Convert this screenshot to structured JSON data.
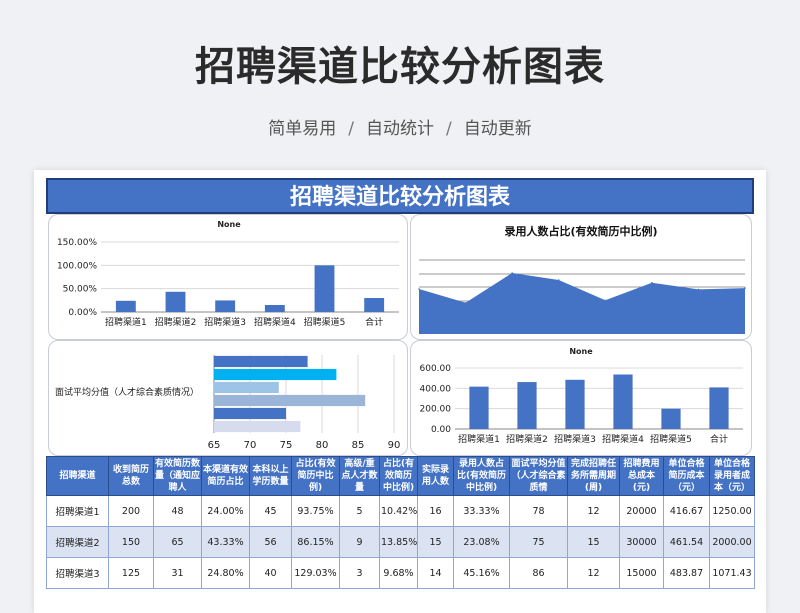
{
  "page": {
    "title": "招聘渠道比较分析图表",
    "subtitle": [
      "简单易用",
      "自动统计",
      "自动更新"
    ],
    "separator": "/"
  },
  "sheet": {
    "banner": "招聘渠道比较分析图表"
  },
  "chart_data": [
    {
      "type": "bar",
      "title": "None",
      "categories": [
        "招聘渠道1",
        "招聘渠道2",
        "招聘渠道3",
        "招聘渠道4",
        "招聘渠道5",
        "合计"
      ],
      "values": [
        24.0,
        43.33,
        24.8,
        15.0,
        100.0,
        30.0
      ],
      "yticks": [
        "0.00%",
        "50.00%",
        "100.00%",
        "150.00%"
      ],
      "ylim": [
        0,
        150
      ],
      "color": "#4472c4"
    },
    {
      "type": "area",
      "title": "录用人数占比(有效简历中比例)",
      "values": [
        33.33,
        23.08,
        45.16,
        40.0,
        25.0,
        38.0,
        33.0,
        34.0
      ],
      "ylim": [
        0,
        60
      ],
      "color": "#4472c4"
    },
    {
      "type": "bar",
      "orientation": "horizontal",
      "ylabel": "面试平均分值（人才综合素质情况）",
      "values": [
        78,
        82,
        74,
        86,
        75,
        77
      ],
      "colors": [
        "#4472c4",
        "#00b0f0",
        "#9dc3e6",
        "#9bb5d9",
        "#4472c4",
        "#d6dced"
      ],
      "xticks": [
        "65",
        "70",
        "75",
        "80",
        "85",
        "90"
      ],
      "xlim": [
        65,
        90
      ]
    },
    {
      "type": "bar",
      "title": "None",
      "categories": [
        "招聘渠道1",
        "招聘渠道2",
        "招聘渠道3",
        "招聘渠道4",
        "招聘渠道5",
        "合计"
      ],
      "values": [
        416.67,
        461.54,
        483.87,
        536.0,
        200.0,
        409.0
      ],
      "yticks": [
        "0.00",
        "200.00",
        "400.00",
        "600.00"
      ],
      "ylim": [
        0,
        600
      ],
      "color": "#4472c4"
    }
  ],
  "table": {
    "headers": [
      "招聘渠道",
      "收到简历总数",
      "有效简历数量（通知应聘人",
      "本渠道有效简历占比",
      "本科以上学历数量",
      "占比(有效简历中比例)",
      "高级/重点人才数量",
      "占比(有效简历中比例)",
      "实际录用人数",
      "录用人数占比(有效简历中比例)",
      "面试平均分值（人才综合素质情",
      "完成招聘任务所需周期(周)",
      "招聘费用总成本(元)",
      "单位合格简历成本（元）",
      "单位合格录用者成本（元）"
    ],
    "rows": [
      [
        "招聘渠道1",
        "200",
        "48",
        "24.00%",
        "45",
        "93.75%",
        "5",
        "10.42%",
        "16",
        "33.33%",
        "78",
        "12",
        "20000",
        "416.67",
        "1250.00"
      ],
      [
        "招聘渠道2",
        "150",
        "65",
        "43.33%",
        "56",
        "86.15%",
        "9",
        "13.85%",
        "15",
        "23.08%",
        "75",
        "15",
        "30000",
        "461.54",
        "2000.00"
      ],
      [
        "招聘渠道3",
        "125",
        "31",
        "24.80%",
        "40",
        "129.03%",
        "3",
        "9.68%",
        "14",
        "45.16%",
        "86",
        "12",
        "15000",
        "483.87",
        "1071.43"
      ]
    ]
  }
}
